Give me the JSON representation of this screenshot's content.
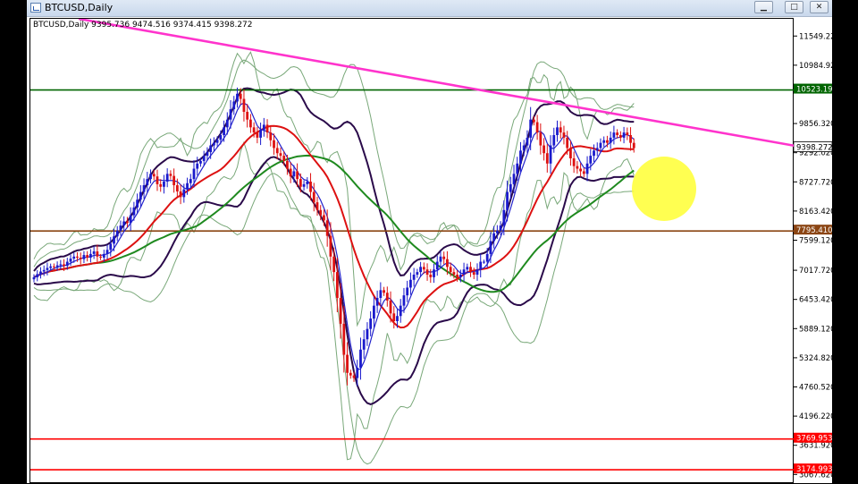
{
  "window": {
    "title": "BTCUSD,Daily",
    "minimize_glyph": "▁",
    "maximize_glyph": "□",
    "close_glyph": "✕"
  },
  "chart_data": {
    "type": "candlestick",
    "header": "BTCUSD,Daily  9395.736 9474.516 9374.415 9398.272",
    "ylim": [
      2900,
      11900
    ],
    "y_ticks": [
      11549.22,
      10984.92,
      9856.32,
      9292.02,
      8727.72,
      8163.42,
      7599.12,
      7017.72,
      6453.42,
      5889.12,
      5324.82,
      4760.52,
      4196.22,
      3631.92,
      3067.62
    ],
    "current_price": 9398.272,
    "levels": [
      {
        "label": "10523.195",
        "value": 10523.195,
        "color": "#006400"
      },
      {
        "label": "7795.410",
        "value": 7795.41,
        "color": "#8b4513"
      },
      {
        "label": "3769.953",
        "value": 3769.953,
        "color": "#ff0000"
      },
      {
        "label": "3174.993",
        "value": 3174.993,
        "color": "#ff0000"
      }
    ],
    "trendline": {
      "start": [
        0,
        11900
      ],
      "end": [
        200,
        9600
      ],
      "color": "#ff33cc"
    },
    "closes": [
      6900,
      6960,
      7010,
      7040,
      7080,
      7110,
      7100,
      7130,
      7150,
      7120,
      7200,
      7260,
      7300,
      7280,
      7250,
      7330,
      7280,
      7350,
      7400,
      7300,
      7280,
      7350,
      7430,
      7550,
      7690,
      7800,
      7900,
      7980,
      7950,
      8100,
      8250,
      8400,
      8550,
      8680,
      8800,
      8900,
      8850,
      8700,
      8650,
      8750,
      8900,
      8860,
      8680,
      8560,
      8450,
      8600,
      8720,
      8800,
      9000,
      9100,
      9150,
      9250,
      9320,
      9450,
      9500,
      9560,
      9650,
      9800,
      9950,
      10150,
      10300,
      10450,
      10350,
      10100,
      9950,
      9800,
      9700,
      9600,
      9750,
      9850,
      9700,
      9550,
      9400,
      9300,
      9250,
      9150,
      9000,
      8850,
      8950,
      8800,
      8650,
      8700,
      8750,
      8550,
      8350,
      8200,
      8100,
      8000,
      7700,
      7300,
      7000,
      6500,
      6000,
      5400,
      5050,
      5000,
      4950,
      5150,
      5500,
      5700,
      5900,
      6100,
      6350,
      6500,
      6650,
      6600,
      6450,
      6200,
      6050,
      6150,
      6350,
      6550,
      6700,
      6850,
      6950,
      7000,
      7100,
      7050,
      6950,
      6900,
      7050,
      7200,
      7300,
      7250,
      7100,
      7000,
      6950,
      6900,
      6950,
      7050,
      7100,
      7000,
      6950,
      7050,
      7200,
      7200,
      7350,
      7600,
      7750,
      7800,
      7900,
      8200,
      8550,
      8700,
      8900,
      9100,
      9350,
      9450,
      9600,
      9950,
      9900,
      9700,
      9450,
      9300,
      9100,
      9450,
      9650,
      9800,
      9700,
      9600,
      9400,
      9200,
      9050,
      9000,
      8950,
      8900,
      9100,
      9250,
      9350,
      9400,
      9500,
      9550,
      9500,
      9600,
      9700,
      9650,
      9600,
      9700,
      9650,
      9500,
      9398
    ]
  }
}
